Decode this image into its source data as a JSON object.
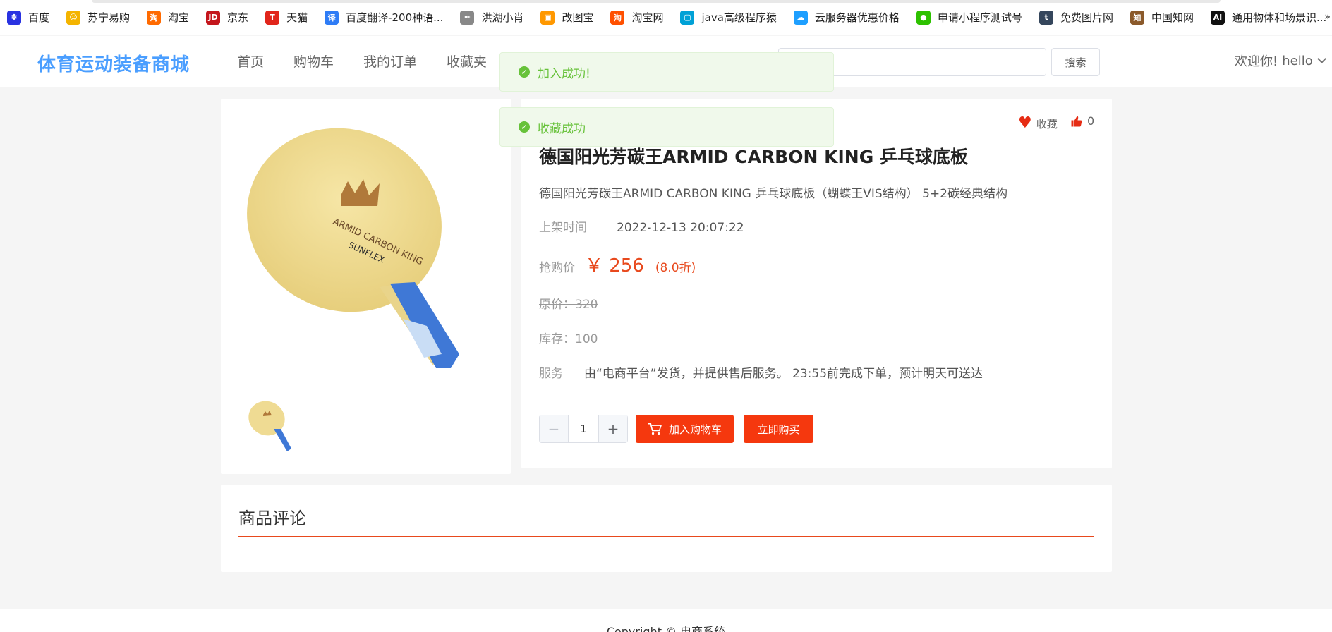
{
  "bookmarks": [
    {
      "label": "百度",
      "icon": "baidu-icon",
      "color": "#2932e1",
      "glyph": "✽"
    },
    {
      "label": "苏宁易购",
      "icon": "suning-icon",
      "color": "#f4b400",
      "glyph": "☺"
    },
    {
      "label": "淘宝",
      "icon": "taobao-icon",
      "color": "#ff6a00",
      "glyph": "淘"
    },
    {
      "label": "京东",
      "icon": "jd-icon",
      "color": "#c4161c",
      "glyph": "JD"
    },
    {
      "label": "天猫",
      "icon": "tmall-icon",
      "color": "#e1251b",
      "glyph": "T"
    },
    {
      "label": "百度翻译-200种语...",
      "icon": "baidu-translate-icon",
      "color": "#2e7cf6",
      "glyph": "译"
    },
    {
      "label": "洪湖小肖",
      "icon": "feather-icon",
      "color": "#888888",
      "glyph": "✒"
    },
    {
      "label": "改图宝",
      "icon": "gaitubao-icon",
      "color": "#ff9800",
      "glyph": "▣"
    },
    {
      "label": "淘宝网",
      "icon": "taobao-net-icon",
      "color": "#ff5000",
      "glyph": "淘"
    },
    {
      "label": "java高级程序猿",
      "icon": "bilibili-icon",
      "color": "#00a1d6",
      "glyph": "▢"
    },
    {
      "label": "云服务器优惠价格",
      "icon": "cloud-icon",
      "color": "#1e9fff",
      "glyph": "☁"
    },
    {
      "label": "申请小程序测试号",
      "icon": "wechat-icon",
      "color": "#2dc100",
      "glyph": "●"
    },
    {
      "label": "免费图片网",
      "icon": "tumblr-icon",
      "color": "#35465c",
      "glyph": "t"
    },
    {
      "label": "中国知网",
      "icon": "cnki-icon",
      "color": "#8b5a2b",
      "glyph": "知"
    },
    {
      "label": "通用物体和场景识...",
      "icon": "ai-icon",
      "color": "#111111",
      "glyph": "AI"
    }
  ],
  "bookmarks_close": "»",
  "header": {
    "logo": "体育运动装备商城",
    "nav": [
      "首页",
      "购物车",
      "我的订单",
      "收藏夹"
    ],
    "search_button": "搜索",
    "search_placeholder": "",
    "welcome": "欢迎你!",
    "username": "hello"
  },
  "toasts": [
    "加入成功!",
    "收藏成功"
  ],
  "product": {
    "favorite_label": "收藏",
    "like_count": "0",
    "title": "德国阳光芳碳王ARMID CARBON KING 乒乓球底板",
    "description": "德国阳光芳碳王ARMID CARBON KING 乒乓球底板（蝴蝶王VIS结构） 5+2碳经典结构",
    "listed_label": "上架时间",
    "listed_time": "2022-12-13 20:07:22",
    "price_label": "抢购价",
    "price": "￥ 256",
    "discount": "(8.0折)",
    "original_price": "原价：320",
    "stock": "库存：100",
    "service_label": "服务",
    "service_text": "由“电商平台”发货，并提供售后服务。 23:55前完成下单，预计明天可送达",
    "quantity": "1",
    "add_to_cart": "加入购物车",
    "buy_now": "立即购买"
  },
  "reviews": {
    "title": "商品评论"
  },
  "footer": {
    "copyright": "Copyright © 电商系统"
  },
  "colors": {
    "accent": "#f5380e",
    "logo": "#4a9eff",
    "success": "#67c23a",
    "favorite": "#e62c14"
  }
}
